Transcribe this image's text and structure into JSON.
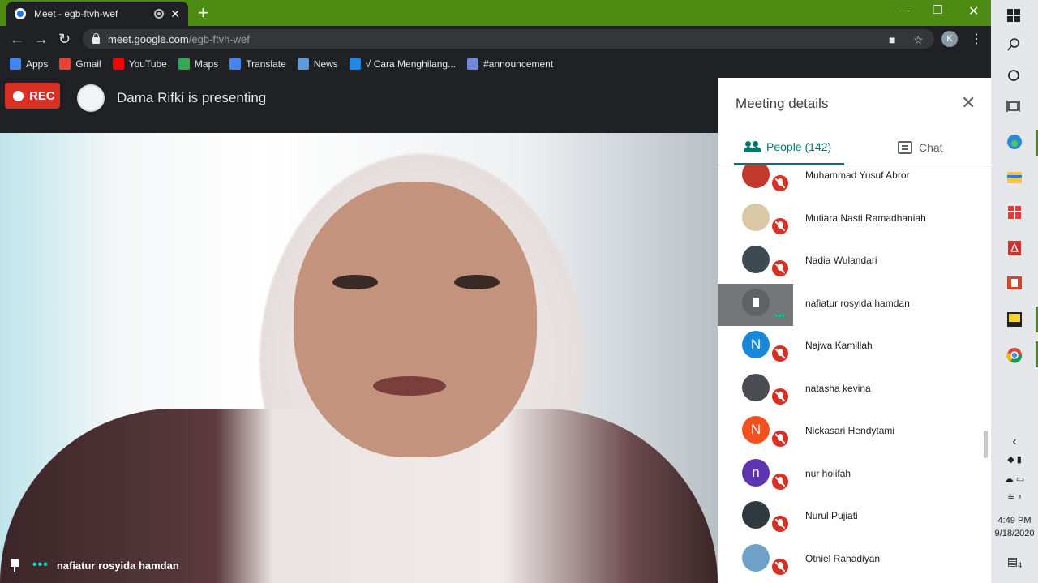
{
  "browser": {
    "tab_title": "Meet - egb-ftvh-wef",
    "url_host": "meet.google.com",
    "url_path": "/egb-ftvh-wef",
    "profile_initial": "K",
    "bookmarks": [
      {
        "label": "Apps",
        "icon": "apps-grid-icon",
        "color": "#4285f4"
      },
      {
        "label": "Gmail",
        "icon": "gmail-icon",
        "color": "#ea4335"
      },
      {
        "label": "YouTube",
        "icon": "youtube-icon",
        "color": "#ff0000"
      },
      {
        "label": "Maps",
        "icon": "maps-icon",
        "color": "#34a853"
      },
      {
        "label": "Translate",
        "icon": "translate-icon",
        "color": "#4285f4"
      },
      {
        "label": "News",
        "icon": "news-icon",
        "color": "#5f9bd8"
      },
      {
        "label": "√ Cara Menghilang...",
        "icon": "site-icon",
        "color": "#1e88e5"
      },
      {
        "label": "#announcement",
        "icon": "discord-icon",
        "color": "#7289da"
      }
    ]
  },
  "meet": {
    "rec_label": "REC",
    "presenting_text": "Dama Rifki is presenting",
    "video_name": "nafiatur rosyida hamdan"
  },
  "panel": {
    "title": "Meeting details",
    "people_tab": "People (142)",
    "chat_tab": "Chat",
    "participants": [
      {
        "name": "Muhammad Yusuf Abror",
        "initial": "",
        "color": "#c0392b",
        "muted": true,
        "highlight": false
      },
      {
        "name": "Mutiara Nasti Ramadhaniah",
        "initial": "",
        "color": "#d9c7a6",
        "muted": true,
        "highlight": false
      },
      {
        "name": "Nadia Wulandari",
        "initial": "",
        "color": "#3e4a52",
        "muted": true,
        "highlight": false
      },
      {
        "name": "nafiatur rosyida hamdan",
        "initial": "",
        "color": "#5f6368",
        "muted": false,
        "highlight": true
      },
      {
        "name": "Najwa Kamillah",
        "initial": "N",
        "color": "#1a88d8",
        "muted": true,
        "highlight": false
      },
      {
        "name": "natasha kevina",
        "initial": "",
        "color": "#4b4b52",
        "muted": true,
        "highlight": false
      },
      {
        "name": "Nickasari Hendytami",
        "initial": "N",
        "color": "#f4511e",
        "muted": true,
        "highlight": false
      },
      {
        "name": "nur holifah",
        "initial": "n",
        "color": "#5e35b1",
        "muted": true,
        "highlight": false
      },
      {
        "name": "Nurul Pujiati",
        "initial": "",
        "color": "#2f3a3f",
        "muted": true,
        "highlight": false
      },
      {
        "name": "Otniel Rahadiyan",
        "initial": "",
        "color": "#6fa0c8",
        "muted": true,
        "highlight": false
      }
    ]
  },
  "taskbar": {
    "time": "4:49 PM",
    "date": "9/18/2020",
    "notification_count": "4"
  }
}
